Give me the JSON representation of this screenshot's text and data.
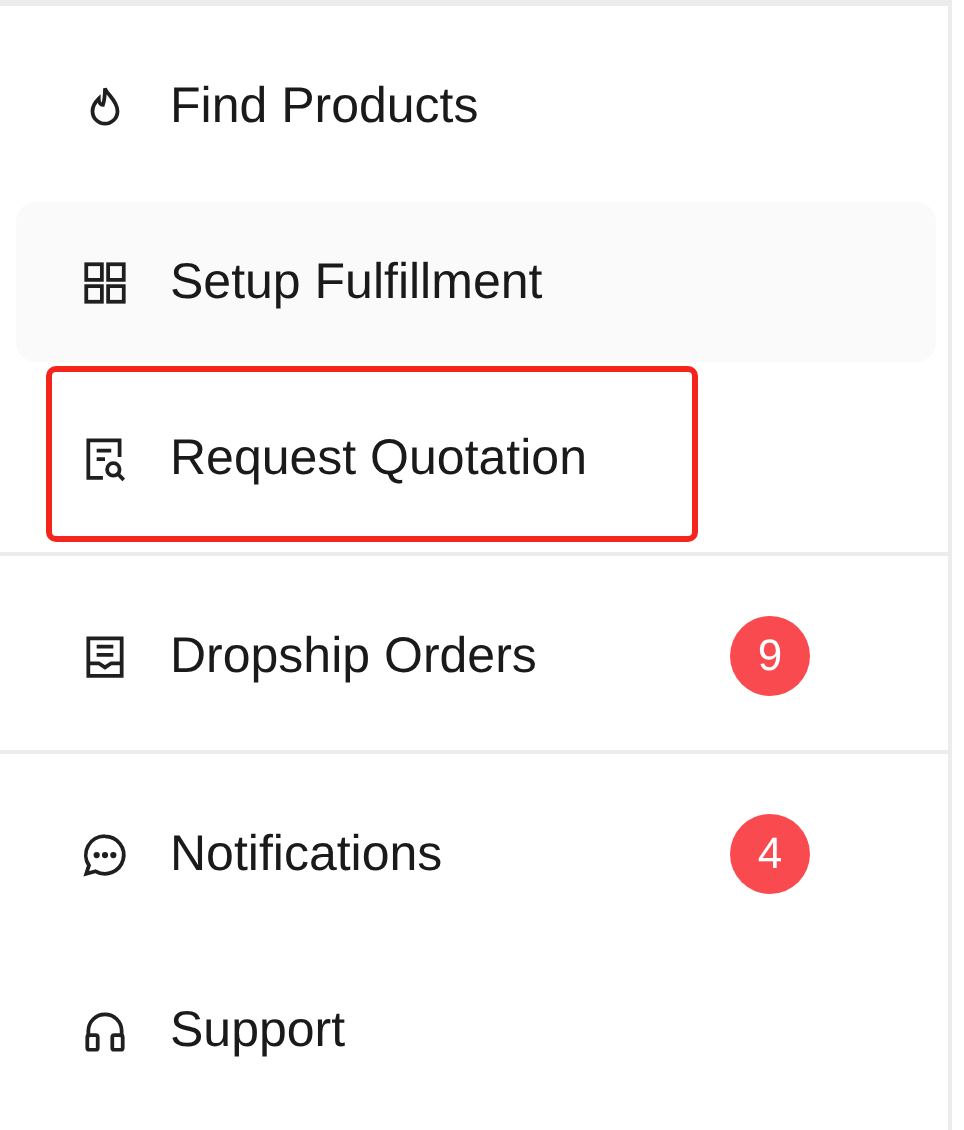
{
  "groups": [
    {
      "items": [
        {
          "label": "Find Products",
          "hovered": false,
          "highlighted": false
        },
        {
          "label": "Setup Fulfillment",
          "hovered": true,
          "highlighted": false
        },
        {
          "label": "Request Quotation",
          "hovered": false,
          "highlighted": true
        }
      ]
    },
    {
      "items": [
        {
          "label": "Dropship Orders",
          "hovered": false,
          "highlighted": false,
          "badge": "9"
        }
      ]
    },
    {
      "items": [
        {
          "label": "Notifications",
          "hovered": false,
          "highlighted": false,
          "badge": "4"
        },
        {
          "label": "Support",
          "hovered": false,
          "highlighted": false
        }
      ]
    }
  ]
}
